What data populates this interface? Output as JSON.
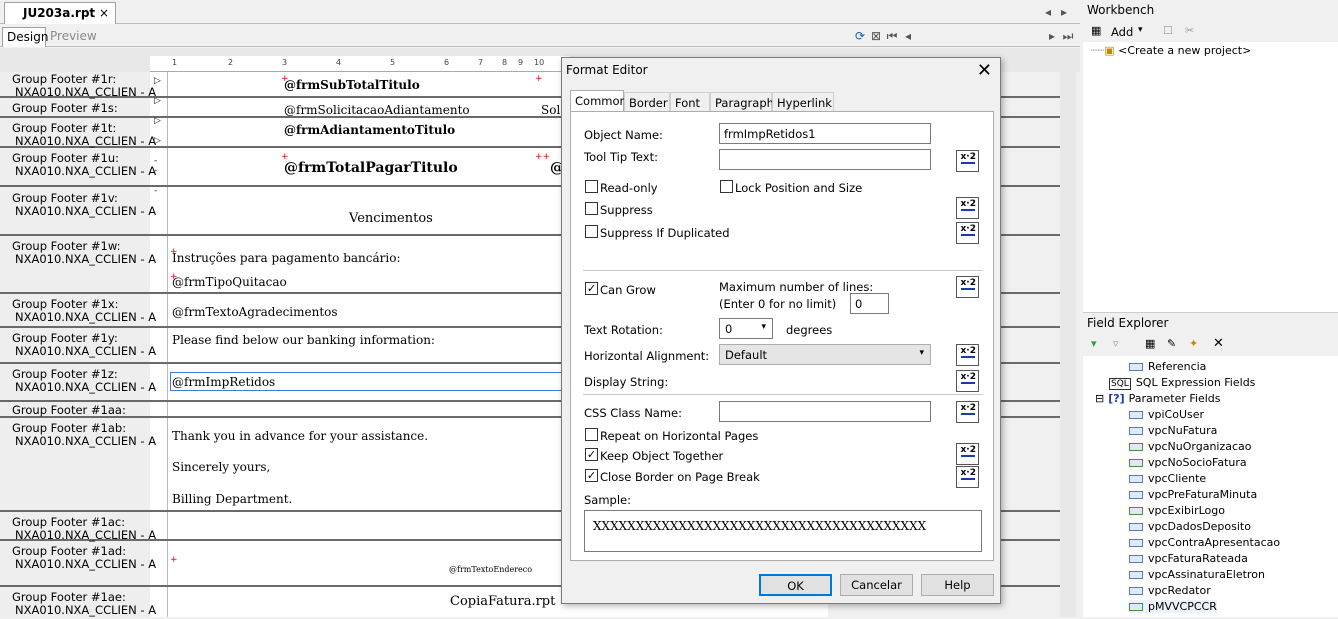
{
  "doc_tab": {
    "title": "JU203a.rpt",
    "close": "×"
  },
  "view_tabs": {
    "design": "Design",
    "preview": "Preview"
  },
  "ruler": {
    "marks": [
      "1",
      "2",
      "3",
      "4",
      "5",
      "6",
      "7",
      "8",
      "9",
      "10"
    ]
  },
  "sections": [
    {
      "label1": "Group Footer #1r:",
      "label2": "NXA010.NXA_CCLIEN - A"
    },
    {
      "label1": "Group Footer #1s:",
      "label2": ""
    },
    {
      "label1": "Group Footer #1t:",
      "label2": "NXA010.NXA_CCLIEN - A"
    },
    {
      "label1": "Group Footer #1u:",
      "label2": "NXA010.NXA_CCLIEN - A"
    },
    {
      "label1": "Group Footer #1v:",
      "label2": "NXA010.NXA_CCLIEN - A"
    },
    {
      "label1": "Group Footer #1w:",
      "label2": "NXA010.NXA_CCLIEN - A"
    },
    {
      "label1": "Group Footer #1x:",
      "label2": "NXA010.NXA_CCLIEN - A"
    },
    {
      "label1": "Group Footer #1y:",
      "label2": "NXA010.NXA_CCLIEN - A"
    },
    {
      "label1": "Group Footer #1z:",
      "label2": "NXA010.NXA_CCLIEN - A"
    },
    {
      "label1": "Group Footer #1aa:",
      "label2": ""
    },
    {
      "label1": "Group Footer #1ab:",
      "label2": "NXA010.NXA_CCLIEN - A"
    },
    {
      "label1": "Group Footer #1ac:",
      "label2": "NXA010.NXA_CCLIEN - A"
    },
    {
      "label1": "Group Footer #1ad:",
      "label2": "NXA010.NXA_CCLIEN - A"
    },
    {
      "label1": "Group Footer #1ae:",
      "label2": "NXA010.NXA_CCLIEN - A"
    }
  ],
  "fields": {
    "subtotal": "@frmSubTotalTitulo",
    "solicitacao": "@frmSolicitacaoAdiantamento",
    "solicitacao_cut": "Sol",
    "adiantamento": "@frmAdiantamentoTitulo",
    "total": "@frmTotalPagarTitulo",
    "total_cut": "@",
    "vencimentos": "Vencimentos",
    "instrucoes": "Instruções para pagamento bancário:",
    "tipo_quitacao": "@frmTipoQuitacao",
    "agradecimentos": "@frmTextoAgradecimentos",
    "banking": "Please find below our banking information:",
    "imp_retidos": "@frmImpRetidos",
    "thank_you": "Thank you in advance for your assistance.",
    "sincerely": "Sincerely yours,",
    "billing": "Billing Department.",
    "endereco": "@frmTextoEndereco",
    "copia": "CopiaFatura.rpt"
  },
  "dialog": {
    "title": "Format Editor",
    "tabs": [
      "Common",
      "Border",
      "Font",
      "Paragraph",
      "Hyperlink"
    ],
    "object_name_label": "Object Name:",
    "object_name_value": "frmImpRetidos1",
    "tooltip_label": "Tool Tip Text:",
    "tooltip_value": "",
    "read_only": "Read-only",
    "lock_position": "Lock Position and Size",
    "suppress": "Suppress",
    "suppress_dup": "Suppress If Duplicated",
    "can_grow": "Can Grow",
    "max_lines_label": "Maximum number of lines:",
    "max_lines_hint": "(Enter 0 for no limit)",
    "max_lines_value": "0",
    "text_rotation_label": "Text Rotation:",
    "text_rotation_value": "0",
    "degrees": "degrees",
    "h_align_label": "Horizontal Alignment:",
    "h_align_value": "Default",
    "display_string_label": "Display String:",
    "css_label": "CSS Class Name:",
    "css_value": "",
    "repeat": "Repeat on Horizontal Pages",
    "keep_together": "Keep Object Together",
    "close_border": "Close Border on Page Break",
    "sample_label": "Sample:",
    "sample_value": "XXXXXXXXXXXXXXXXXXXXXXXXXXXXXXXXXXXXXXX",
    "ok": "OK",
    "cancel": "Cancelar",
    "help": "Help",
    "formula_icon": "x·2"
  },
  "workbench": {
    "title": "Workbench",
    "add": "Add",
    "create_project": "<Create a new project>"
  },
  "field_explorer": {
    "title": "Field Explorer",
    "items": [
      {
        "label": "Referencia",
        "kind": "param"
      },
      {
        "label": "SQL Expression Fields",
        "kind": "sql"
      },
      {
        "label": "Parameter Fields",
        "kind": "group"
      },
      {
        "label": "vpiCoUser",
        "kind": "param"
      },
      {
        "label": "vpcNuFatura",
        "kind": "param"
      },
      {
        "label": "vpcNuOrganizacao",
        "kind": "paramcheck"
      },
      {
        "label": "vpcNoSocioFatura",
        "kind": "paramcheck"
      },
      {
        "label": "vpcCliente",
        "kind": "param"
      },
      {
        "label": "vpcPreFaturaMinuta",
        "kind": "param"
      },
      {
        "label": "vpcExibirLogo",
        "kind": "paramcheck"
      },
      {
        "label": "vpcDadosDeposito",
        "kind": "param"
      },
      {
        "label": "vpcContraApresentacao",
        "kind": "param"
      },
      {
        "label": "vpcFaturaRateada",
        "kind": "param"
      },
      {
        "label": "vpcAssinaturaEletron",
        "kind": "param"
      },
      {
        "label": "vpcRedator",
        "kind": "param"
      },
      {
        "label": "pMVVCPCCR",
        "kind": "paramcheck"
      }
    ]
  }
}
